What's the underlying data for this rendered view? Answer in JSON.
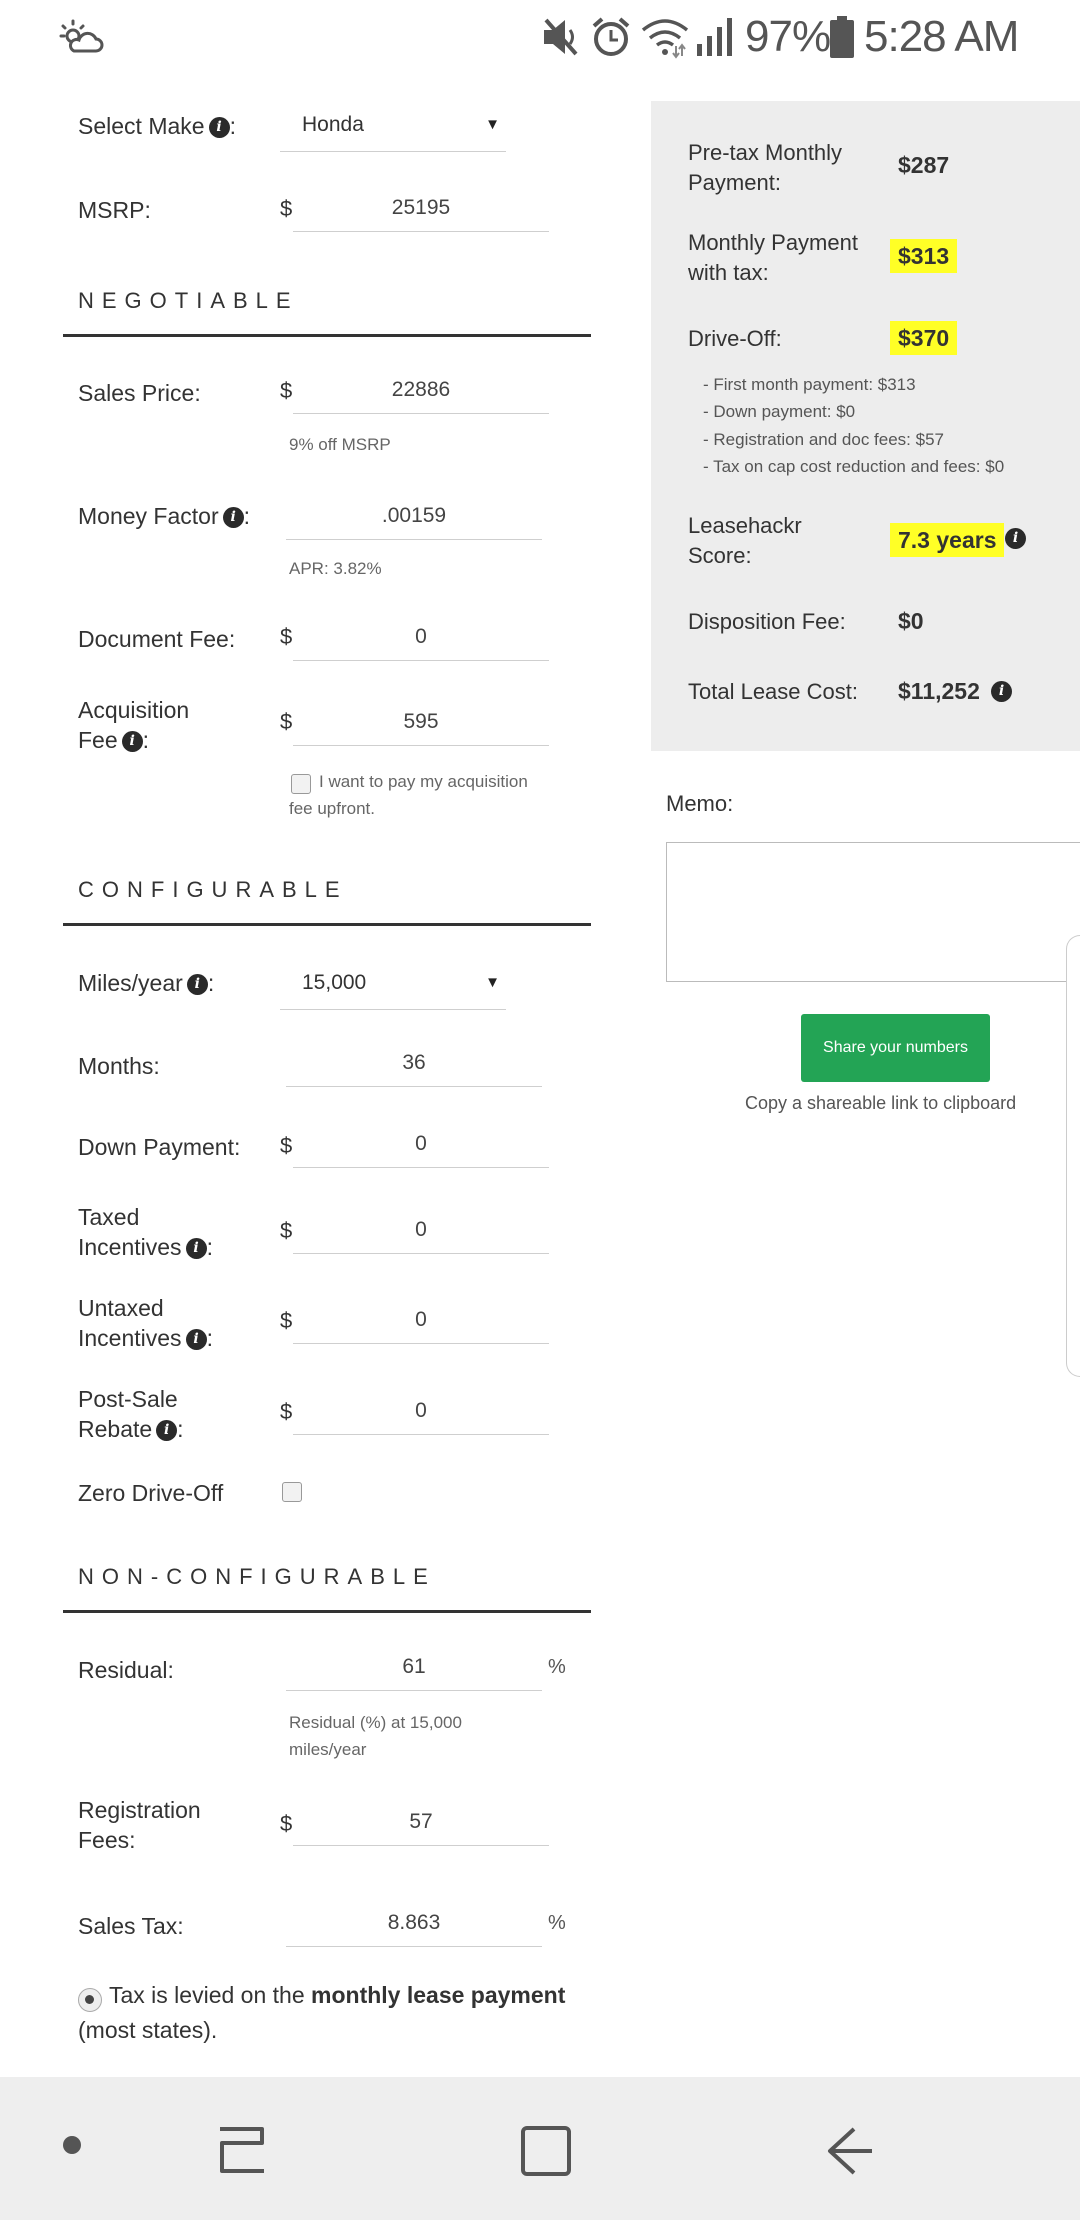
{
  "status_bar": {
    "battery_percent": "97%",
    "time": "5:28 AM",
    "icons": [
      "weather-icon",
      "mute-icon",
      "alarm-icon",
      "wifi-icon",
      "signal-icon",
      "battery-icon"
    ]
  },
  "form": {
    "make": {
      "label": "Select Make",
      "suffix": ":",
      "value": "Honda"
    },
    "msrp": {
      "label": "MSRP:",
      "currency": "$",
      "value": "25195"
    },
    "sections": {
      "negotiable": "NEGOTIABLE",
      "configurable": "CONFIGURABLE",
      "non_configurable": "NON-CONFIGURABLE"
    },
    "sales_price": {
      "label": "Sales Price:",
      "currency": "$",
      "value": "22886",
      "hint": "9% off MSRP"
    },
    "money_factor": {
      "label": "Money Factor",
      "suffix": ":",
      "value": ".00159",
      "hint": "APR: 3.82%"
    },
    "document_fee": {
      "label": "Document Fee:",
      "currency": "$",
      "value": "0"
    },
    "acquisition_fee": {
      "label_line1": "Acquisition",
      "label_line2": "Fee",
      "suffix": ":",
      "currency": "$",
      "value": "595",
      "checkbox_line1": "I want to pay my acquisition",
      "checkbox_line2": "fee upfront."
    },
    "miles_year": {
      "label": "Miles/year",
      "suffix": ":",
      "value": "15,000"
    },
    "months": {
      "label": "Months:",
      "value": "36"
    },
    "down_payment": {
      "label": "Down Payment:",
      "currency": "$",
      "value": "0"
    },
    "taxed_incentives": {
      "label_line1": "Taxed",
      "label_line2": "Incentives",
      "suffix": ":",
      "currency": "$",
      "value": "0"
    },
    "untaxed_incentives": {
      "label_line1": "Untaxed",
      "label_line2": "Incentives",
      "suffix": ":",
      "currency": "$",
      "value": "0"
    },
    "post_sale_rebate": {
      "label_line1": "Post-Sale",
      "label_line2": "Rebate",
      "suffix": ":",
      "currency": "$",
      "value": "0"
    },
    "zero_drive_off": {
      "label": "Zero Drive-Off"
    },
    "residual": {
      "label": "Residual:",
      "value": "61",
      "unit": "%",
      "hint_line1": "Residual (%) at 15,000",
      "hint_line2": "miles/year"
    },
    "registration_fees": {
      "label_line1": "Registration",
      "label_line2": "Fees:",
      "currency": "$",
      "value": "57"
    },
    "sales_tax": {
      "label": "Sales Tax:",
      "value": "8.863",
      "unit": "%"
    },
    "tax_option": {
      "text_before": "Tax is levied on the",
      "bold": "monthly lease payment",
      "text_after": "(most states)."
    }
  },
  "results": {
    "pretax_monthly": {
      "label_line1": "Pre-tax Monthly",
      "label_line2": "Payment:",
      "value": "$287"
    },
    "monthly_with_tax": {
      "label_line1": "Monthly Payment",
      "label_line2": "with tax:",
      "value": "$313"
    },
    "drive_off": {
      "label": "Drive-Off:",
      "value": "$370",
      "breakdown": [
        "- First month payment: $313",
        "- Down payment: $0",
        "- Registration and doc fees: $57",
        "- Tax on cap cost reduction and fees: $0"
      ]
    },
    "leasehackr_score": {
      "label_line1": "Leasehackr",
      "label_line2": "Score:",
      "value": "7.3 years"
    },
    "disposition_fee": {
      "label": "Disposition Fee:",
      "value": "$0"
    },
    "total_lease_cost": {
      "label": "Total Lease Cost:",
      "value": "$11,252"
    }
  },
  "memo": {
    "label": "Memo:",
    "value": ""
  },
  "share": {
    "button_label": "Share your numbers",
    "hint": "Copy a shareable link to clipboard"
  },
  "colors": {
    "highlight": "#ffff26",
    "share_button": "#23a455",
    "panel_bg": "#ededed"
  },
  "nav_bar": {
    "icons": [
      "dot-icon",
      "recents-icon",
      "home-icon",
      "back-icon"
    ]
  }
}
